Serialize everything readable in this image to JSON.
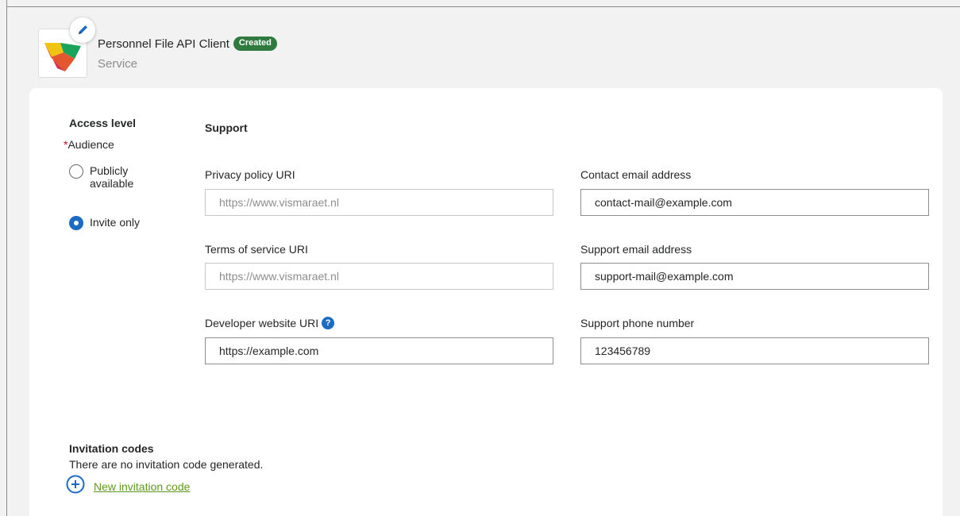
{
  "header": {
    "title": "Personnel File API Client",
    "status": "Created",
    "subtitle": "Service",
    "logo_icon": "visma-logo-icon",
    "edit_icon": "pencil-icon"
  },
  "access": {
    "heading": "Access level",
    "required_mark": "*",
    "audience_label": "Audience",
    "options": [
      {
        "label_line1": "Publicly",
        "label_line2": "available",
        "selected": false
      },
      {
        "label": "Invite only",
        "selected": true
      }
    ]
  },
  "support": {
    "heading": "Support",
    "privacy": {
      "label": "Privacy policy URI",
      "placeholder": "https://www.vismaraet.nl",
      "value": ""
    },
    "terms": {
      "label": "Terms of service URI",
      "placeholder": "https://www.vismaraet.nl",
      "value": ""
    },
    "developer": {
      "label": "Developer website URI",
      "value": "https://example.com",
      "help_icon": "question-icon",
      "help_glyph": "?"
    },
    "contact_email": {
      "label": "Contact email address",
      "value": "contact-mail@example.com"
    },
    "support_email": {
      "label": "Support email address",
      "value": "support-mail@example.com"
    },
    "support_phone": {
      "label": "Support phone number",
      "value": "123456789"
    }
  },
  "invitations": {
    "heading": "Invitation codes",
    "empty_text": "There are no invitation code generated.",
    "new_link": "New invitation code",
    "add_icon": "plus-circle-icon"
  },
  "colors": {
    "accent_blue": "#1b6bc5",
    "status_green": "#2f7a3e",
    "link_green": "#5e9a1d",
    "required_red": "#c8102e"
  }
}
